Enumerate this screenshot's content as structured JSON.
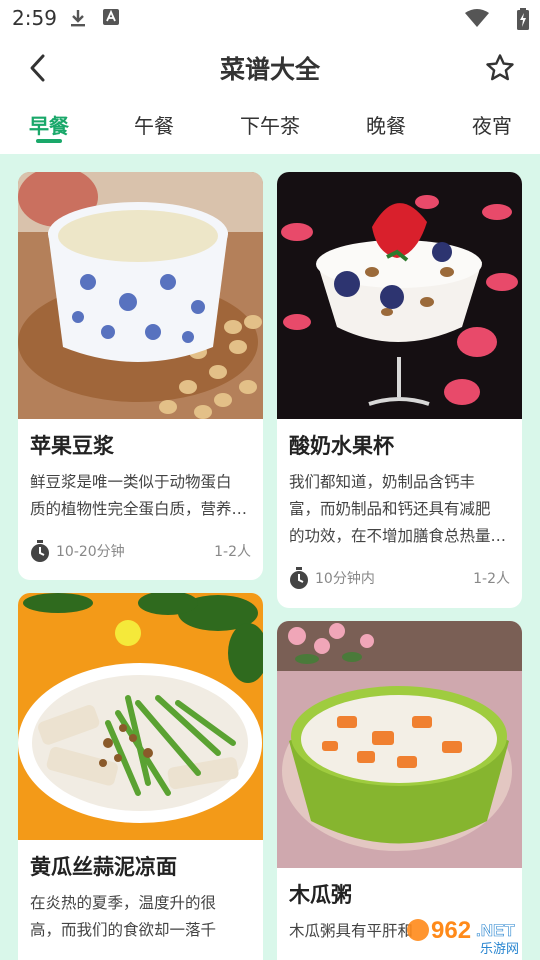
{
  "status": {
    "time": "2:59",
    "icons": [
      "download-icon",
      "app-notification-icon",
      "wifi-icon",
      "battery-charging-icon"
    ]
  },
  "header": {
    "title": "菜谱大全",
    "back_icon": "chevron-left-icon",
    "favorite_icon": "star-outline-icon"
  },
  "tabs": [
    {
      "label": "早餐",
      "active": true
    },
    {
      "label": "午餐",
      "active": false
    },
    {
      "label": "下午茶",
      "active": false
    },
    {
      "label": "晚餐",
      "active": false
    },
    {
      "label": "夜宵",
      "active": false
    }
  ],
  "colors": {
    "accent": "#1aa86a",
    "background": "#d9f7ea"
  },
  "recipes": [
    {
      "title": "苹果豆浆",
      "desc_line1": "鲜豆浆是唯一类似于动物蛋白",
      "desc_line2": "质的植物性完全蛋白质，营养…",
      "desc_line3": "",
      "time": "10-20分钟",
      "servings": "1-2人"
    },
    {
      "title": "酸奶水果杯",
      "desc_line1": "我们都知道，奶制品含钙丰",
      "desc_line2": "富，而奶制品和钙还具有减肥",
      "desc_line3": "的功效，在不增加膳食总热量…",
      "time": "10分钟内",
      "servings": "1-2人"
    },
    {
      "title": "黄瓜丝蒜泥凉面",
      "desc_line1": "在炎热的夏季，温度升的很",
      "desc_line2": "高，而我们的食欲却一落千",
      "desc_line3": "",
      "time": "",
      "servings": ""
    },
    {
      "title": "木瓜粥",
      "desc_line1": "木瓜粥具有平肝和",
      "desc_line2": "",
      "desc_line3": "",
      "time": "",
      "servings": ""
    }
  ],
  "watermark": {
    "number": "962",
    "domain": ".NET",
    "site": "乐游网"
  }
}
